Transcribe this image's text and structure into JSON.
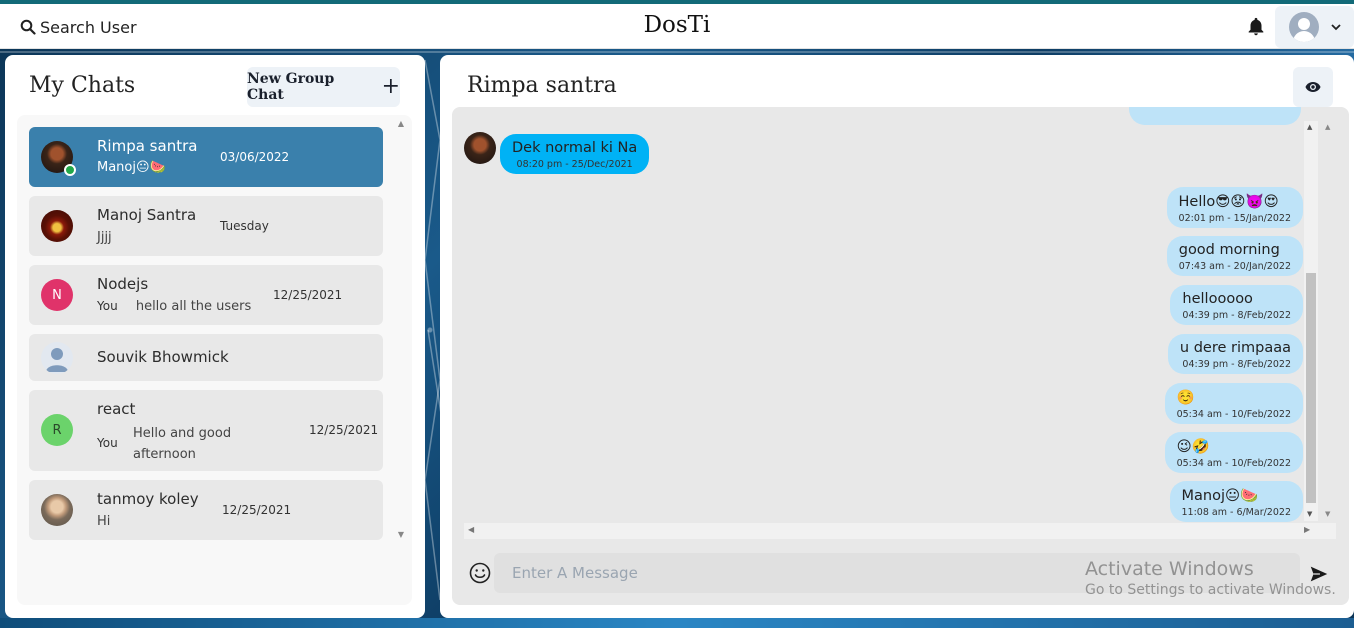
{
  "header": {
    "search_label": "Search User",
    "app_title": "DosTi"
  },
  "sidebar": {
    "title": "My Chats",
    "new_group_label": "New Group Chat",
    "chats": [
      {
        "name": "Rimpa santra",
        "preview": "Manoj😐🍉",
        "date": "03/06/2022",
        "active": true,
        "online": true
      },
      {
        "name": "Manoj Santra",
        "preview": "Jjjj",
        "date": "Tuesday"
      },
      {
        "name": "Nodejs",
        "initial": "N",
        "you_label": "You",
        "preview": "hello all the users",
        "date": "12/25/2021"
      },
      {
        "name": "Souvik Bhowmick"
      },
      {
        "name": "react",
        "initial": "R",
        "you_label": "You",
        "preview_line1": "Hello and good",
        "preview_line2": "afternoon",
        "date": "12/25/2021"
      },
      {
        "name": "tanmoy koley",
        "preview": "Hi",
        "date": "12/25/2021"
      }
    ]
  },
  "conversation": {
    "title": "Rimpa santra",
    "messages": [
      {
        "dir": "in",
        "text": "Dek normal ki Na",
        "time": "08:20 pm - 25/Dec/2021"
      },
      {
        "dir": "out",
        "text": "Hello😎😟👿😍",
        "time": "02:01 pm - 15/Jan/2022"
      },
      {
        "dir": "out",
        "text": "good morning",
        "time": "07:43 am - 20/Jan/2022"
      },
      {
        "dir": "out",
        "text": "hellooooo",
        "time": "04:39 pm - 8/Feb/2022"
      },
      {
        "dir": "out",
        "text": "u dere rimpaaa",
        "time": "04:39 pm - 8/Feb/2022"
      },
      {
        "dir": "out",
        "text": "☺️",
        "time": "05:34 am - 10/Feb/2022"
      },
      {
        "dir": "out",
        "text": "😉🤣",
        "time": "05:34 am - 10/Feb/2022"
      },
      {
        "dir": "out",
        "text": "Manoj😐🍉",
        "time": "11:08 am - 6/Mar/2022"
      }
    ],
    "input_placeholder": "Enter A Message"
  },
  "watermark": {
    "line1": "Activate Windows",
    "line2": "Go to Settings to activate Windows."
  },
  "colors": {
    "active_chat": "#3a80ac",
    "incoming_bubble": "#00b2f5",
    "outgoing_bubble": "#bee3f8",
    "online": "#22a84a"
  }
}
